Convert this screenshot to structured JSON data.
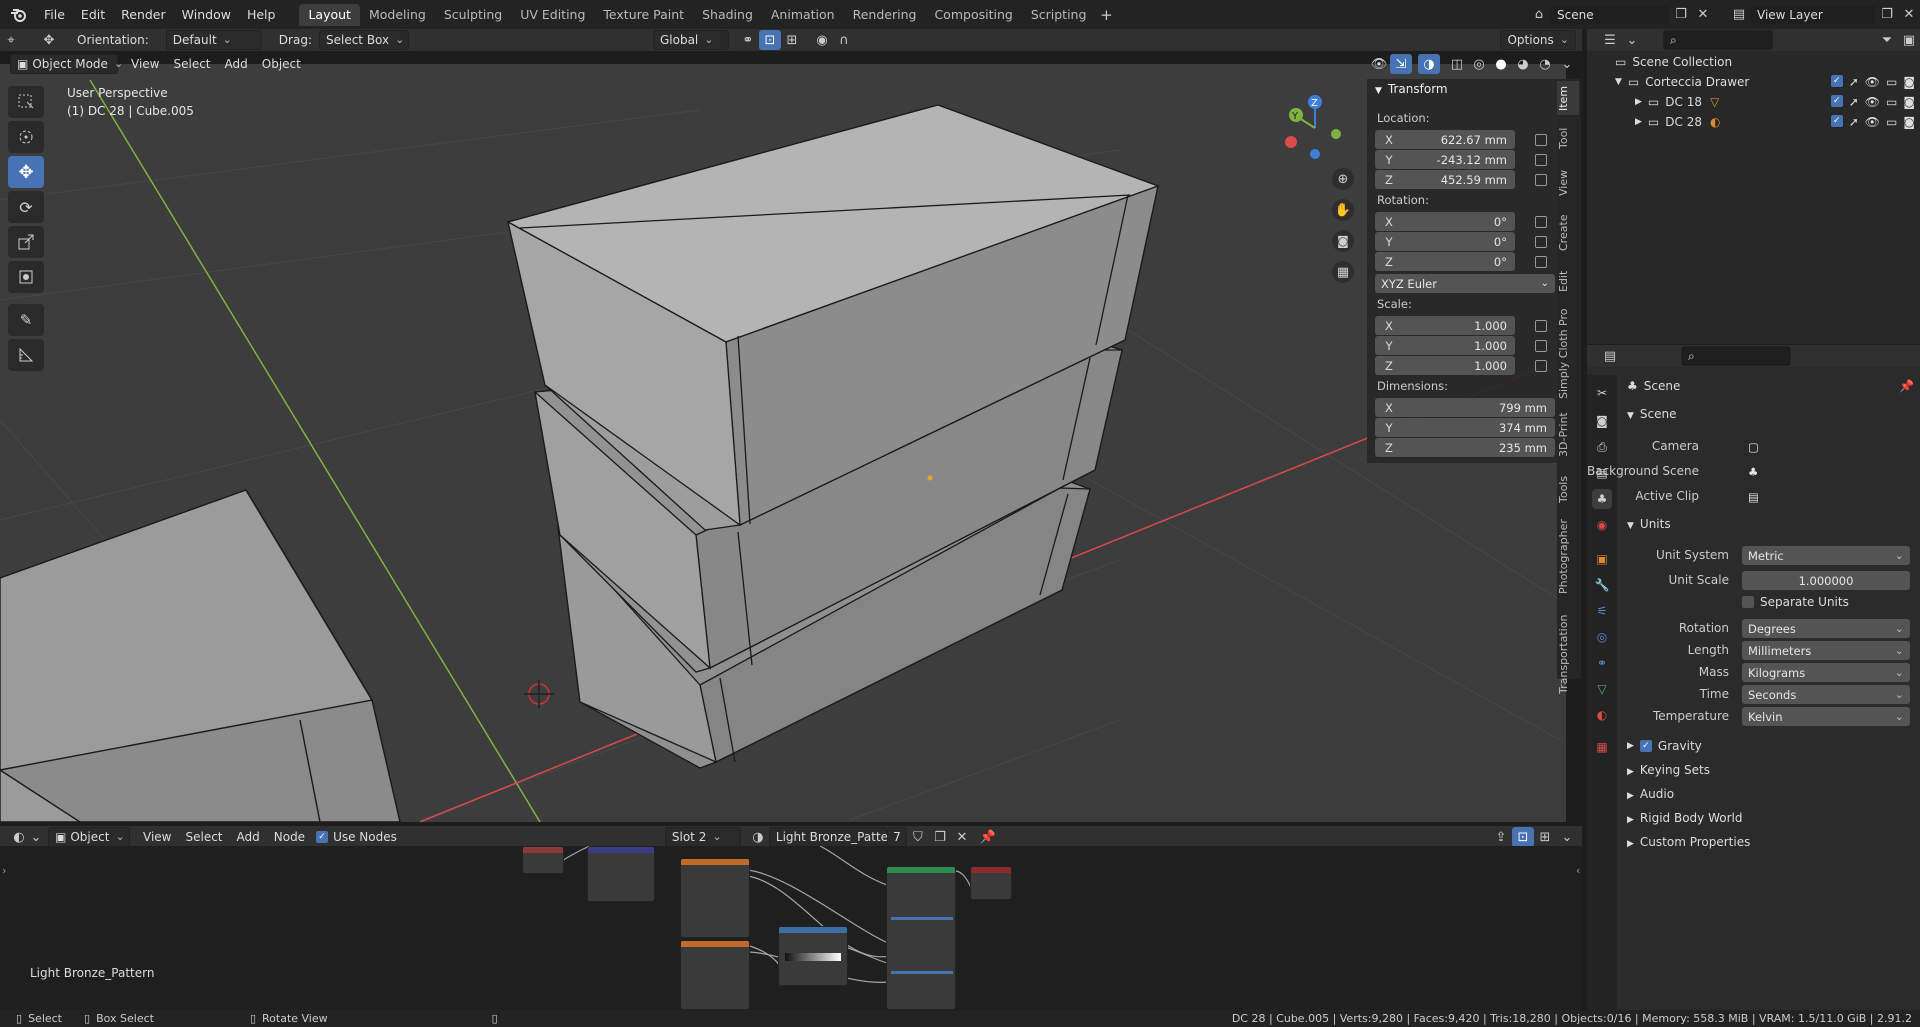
{
  "topbar": {
    "menus": [
      "File",
      "Edit",
      "Render",
      "Window",
      "Help"
    ],
    "workspaces": [
      "Layout",
      "Modeling",
      "Sculpting",
      "UV Editing",
      "Texture Paint",
      "Shading",
      "Animation",
      "Rendering",
      "Compositing",
      "Scripting"
    ],
    "active_workspace": "Layout",
    "scene": "Scene",
    "view_layer": "View Layer"
  },
  "tool_header": {
    "orientation_label": "Orientation:",
    "orientation_value": "Default",
    "drag_label": "Drag:",
    "drag_value": "Select Box",
    "transform_orientation": "Global",
    "options": "Options"
  },
  "viewport_header": {
    "mode": "Object Mode",
    "menus": [
      "View",
      "Select",
      "Add",
      "Object"
    ]
  },
  "viewport": {
    "perspective": "User Perspective",
    "object_info": "(1) DC 28 | Cube.005"
  },
  "transform_panel": {
    "title": "Transform",
    "location_label": "Location:",
    "location": [
      {
        "axis": "X",
        "value": "622.67 mm"
      },
      {
        "axis": "Y",
        "value": "-243.12 mm"
      },
      {
        "axis": "Z",
        "value": "452.59 mm"
      }
    ],
    "rotation_label": "Rotation:",
    "rotation": [
      {
        "axis": "X",
        "value": "0°"
      },
      {
        "axis": "Y",
        "value": "0°"
      },
      {
        "axis": "Z",
        "value": "0°"
      }
    ],
    "rotation_mode": "XYZ Euler",
    "scale_label": "Scale:",
    "scale": [
      {
        "axis": "X",
        "value": "1.000"
      },
      {
        "axis": "Y",
        "value": "1.000"
      },
      {
        "axis": "Z",
        "value": "1.000"
      }
    ],
    "dimensions_label": "Dimensions:",
    "dimensions": [
      {
        "axis": "X",
        "value": "799 mm"
      },
      {
        "axis": "Y",
        "value": "374 mm"
      },
      {
        "axis": "Z",
        "value": "235 mm"
      }
    ]
  },
  "sidebar_tabs": [
    "Item",
    "Tool",
    "View",
    "Create",
    "Edit",
    "Simply Cloth Pro",
    "3D-Print",
    "Tools",
    "Photographer",
    "Transportation"
  ],
  "outliner": {
    "root": "Scene Collection",
    "collection": "Corteccia Drawer",
    "children": [
      "DC 18",
      "DC 28"
    ]
  },
  "properties": {
    "header": "Scene",
    "scene_section": "Scene",
    "camera_label": "Camera",
    "background_scene_label": "Background Scene",
    "active_clip_label": "Active Clip",
    "units_section": "Units",
    "unit_system_label": "Unit System",
    "unit_system": "Metric",
    "unit_scale_label": "Unit Scale",
    "unit_scale": "1.000000",
    "separate_units": "Separate Units",
    "rotation_label": "Rotation",
    "rotation": "Degrees",
    "length_label": "Length",
    "length": "Millimeters",
    "mass_label": "Mass",
    "mass": "Kilograms",
    "time_label": "Time",
    "time": "Seconds",
    "temperature_label": "Temperature",
    "temperature": "Kelvin",
    "collapsed": [
      "Gravity",
      "Keying Sets",
      "Audio",
      "Rigid Body World",
      "Custom Properties"
    ]
  },
  "node_editor": {
    "object_type": "Object",
    "menus": [
      "View",
      "Select",
      "Add",
      "Node"
    ],
    "use_nodes": "Use Nodes",
    "slot": "Slot 2",
    "material": "Light Bronze_Pattern",
    "users": "7",
    "material_label": "Light Bronze_Pattern"
  },
  "statusbar": {
    "select": "Select",
    "box_select": "Box Select",
    "rotate_view": "Rotate View",
    "stats": "DC 28 | Cube.005 | Verts:9,280 | Faces:9,420 | Tris:18,280 | Objects:0/16 | Memory: 558.3 MiB | VRAM: 1.5/11.0 GiB | 2.91.2"
  },
  "colors": {
    "accent": "#4772b3",
    "viewport_bg": "#3d3d3d",
    "x_axis": "#d94a4a",
    "y_axis": "#7fb341",
    "z_axis": "#3f7ed9"
  }
}
